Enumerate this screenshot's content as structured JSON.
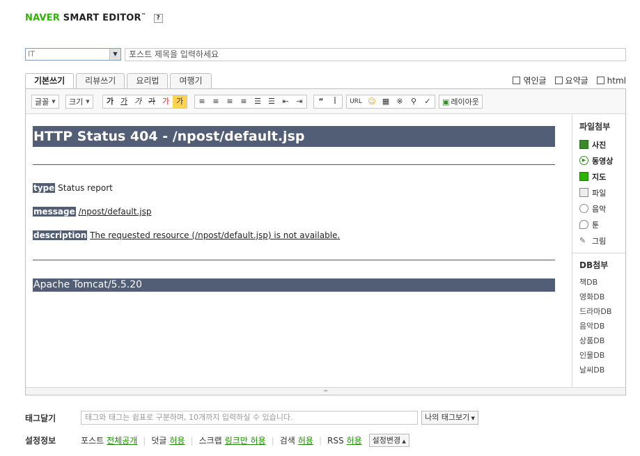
{
  "logo": {
    "brand": "NAVER",
    "product": "SMART EDITOR",
    "tm": "™",
    "help": "?"
  },
  "category": {
    "value": "IT"
  },
  "title": {
    "placeholder": "포스트 제목을 입력하세요"
  },
  "tabs": [
    {
      "label": "기본쓰기",
      "active": true
    },
    {
      "label": "리뷰쓰기"
    },
    {
      "label": "요리법"
    },
    {
      "label": "여행기"
    }
  ],
  "options": [
    {
      "label": "엮인글"
    },
    {
      "label": "요약글"
    },
    {
      "label": "html"
    }
  ],
  "toolbar": {
    "font": "글꼴",
    "size": "크기",
    "bold": "가",
    "underline": "가",
    "italic": "가",
    "strike": "가",
    "color": "가",
    "bgcolor": "가",
    "url": "URL",
    "layout": "레이아웃"
  },
  "content": {
    "heading": "HTTP Status 404 - /npost/default.jsp",
    "type_label": "type",
    "type_value": "Status report",
    "message_label": "message",
    "message_value": "/npost/default.jsp",
    "description_label": "description",
    "description_value": "The requested resource (/npost/default.jsp) is not available.",
    "footer": "Apache Tomcat/5.5.20"
  },
  "sidebar": {
    "attach_title": "파일첨부",
    "attach_items": [
      {
        "label": "사진",
        "icon": "photo-icon"
      },
      {
        "label": "동영상",
        "icon": "video-icon"
      },
      {
        "label": "지도",
        "icon": "map-icon"
      },
      {
        "label": "파일",
        "icon": "file-icon"
      },
      {
        "label": "음악",
        "icon": "music-icon"
      },
      {
        "label": "툰",
        "icon": "toon-icon"
      },
      {
        "label": "그림",
        "icon": "draw-icon"
      }
    ],
    "db_title": "DB첨부",
    "db_items": [
      {
        "label": "책DB"
      },
      {
        "label": "영화DB"
      },
      {
        "label": "드라마DB"
      },
      {
        "label": "음악DB"
      },
      {
        "label": "상품DB"
      },
      {
        "label": "인물DB"
      },
      {
        "label": "날씨DB"
      }
    ]
  },
  "tags": {
    "label": "태그달기",
    "placeholder": "태그와 태그는 쉼표로 구분하며, 10개까지 입력하실 수 있습니다.",
    "my_tags": "나의 태그보기"
  },
  "settings": {
    "label": "설정정보",
    "post_label": "포스트",
    "post_value": "전체공개",
    "comment_label": "덧글",
    "comment_value": "허용",
    "scrap_label": "스크랩",
    "scrap_value": "링크만 허용",
    "search_label": "검색",
    "search_value": "허용",
    "rss_label": "RSS",
    "rss_value": "허용",
    "change_button": "설정변경"
  }
}
